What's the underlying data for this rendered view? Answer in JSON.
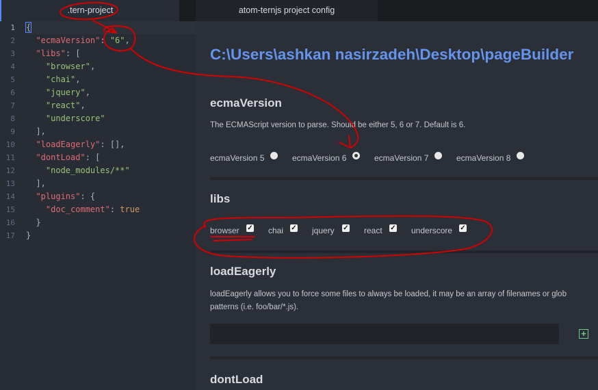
{
  "tabs": [
    {
      "label": ".tern-project"
    },
    {
      "label": "atom-ternjs project config"
    }
  ],
  "editor": {
    "line_numbers": [
      "1",
      "2",
      "3",
      "4",
      "5",
      "6",
      "7",
      "8",
      "9",
      "10",
      "11",
      "12",
      "13",
      "14",
      "15",
      "16",
      "17"
    ]
  },
  "config": {
    "path": "C:\\Users\\ashkan nasirzadeh\\Desktop\\pageBuilder",
    "ecma": {
      "title": "ecmaVersion",
      "description": "The ECMAScript version to parse. Should be either 5, 6 or 7. Default is 6.",
      "options": [
        "ecmaVersion 5",
        "ecmaVersion 6",
        "ecmaVersion 7",
        "ecmaVersion 8"
      ],
      "selected": "ecmaVersion 6"
    },
    "libs": {
      "title": "libs",
      "items": [
        "browser",
        "chai",
        "jquery",
        "react",
        "underscore"
      ]
    },
    "loadEagerly": {
      "title": "loadEagerly",
      "description": "loadEagerly allows you to force some files to always be loaded, it may be an array of filenames or glob patterns (i.e. foo/bar/*.js)."
    },
    "dontLoad": {
      "title": "dontLoad"
    }
  },
  "colors": {
    "accent": "#6494ed",
    "annotation": "#d40000"
  }
}
